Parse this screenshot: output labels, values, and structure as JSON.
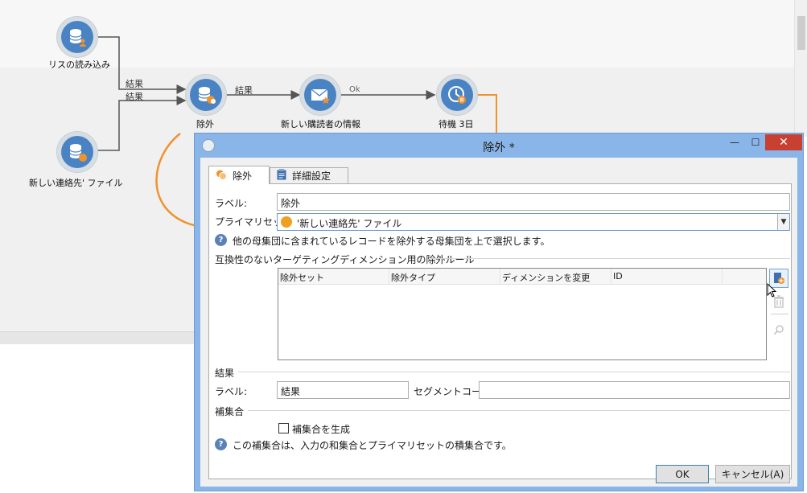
{
  "workflow": {
    "nodes": [
      {
        "label": "リスの読み込み",
        "icon": "database-user-icon"
      },
      {
        "label": "新しい連絡先' ファイル",
        "icon": "database-file-icon"
      },
      {
        "label": "除外",
        "icon": "database-exclusion-icon"
      },
      {
        "label": "新しい購読者の情報",
        "icon": "email-delivery-icon"
      },
      {
        "label": "待機 3日",
        "icon": "wait-clock-icon"
      }
    ],
    "links": {
      "result_1": "結果",
      "result_2": "結果",
      "result_3": "結果",
      "ok": "Ok"
    },
    "accent_color": "#f0922e",
    "node_color": "#4a83c3"
  },
  "dialog": {
    "title": "除外 *",
    "window_buttons": {
      "minimize": "—",
      "maximize": "☐",
      "close": "✕"
    },
    "tabs": [
      {
        "label": "除外",
        "icon": "exclusion-tab-icon"
      },
      {
        "label": "詳細設定",
        "icon": "clipboard-icon"
      }
    ],
    "label_caption": "ラベル:",
    "label_value": "除外",
    "primary_set_caption": "プライマリセット:",
    "primary_set_value": "'新しい連絡先' ファイル",
    "primary_set_help": "他の母集団に含まれているレコードを除外する母集団を上で選択します。",
    "rules_section": "互換性のないターゲティングディメンション用の除外ルール",
    "grid_columns": [
      "除外セット",
      "除外タイプ",
      "ディメンションを変更",
      "ID"
    ],
    "result_section": "結果",
    "result_label_caption": "ラベル:",
    "result_label_value": "結果",
    "segment_code_caption": "セグメントコード:",
    "segment_code_value": "",
    "complement_section": "補集合",
    "complement_checkbox": "補集合を生成",
    "complement_checked": false,
    "complement_help": "この補集合は、入力の和集合とプライマリセットの積集合です。",
    "ok_button": "OK",
    "cancel_button": "キャンセル(A)"
  }
}
